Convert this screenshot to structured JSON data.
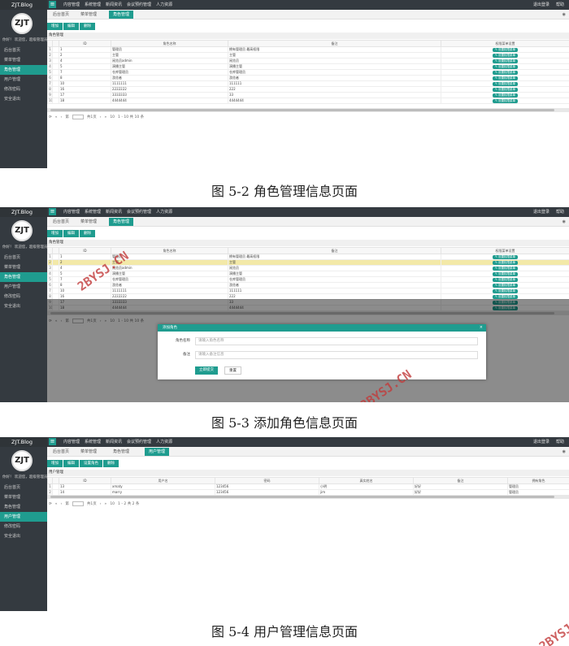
{
  "app": {
    "logo": "ZJT.Blog",
    "avatar_text": "ZJT",
    "welcome": "你好！ 欢迎您，超级管理员",
    "top_nav": [
      "内容管理",
      "系统管理",
      "新闻资讯",
      "会议预约管理",
      "人力资源"
    ],
    "top_right": [
      "退出登录",
      "帮助"
    ]
  },
  "shot1": {
    "sidebar": [
      "后台首页",
      "菜单管理",
      "角色管理",
      "用户管理",
      "修改密码",
      "安全退出"
    ],
    "active_index": 2,
    "tabs": [
      "后台首页",
      "菜单管理",
      "角色管理"
    ],
    "toolbar": [
      "增加",
      "编辑",
      "删除"
    ],
    "panel_title": "角色管理",
    "columns": [
      "ID",
      "角色名称",
      "备注",
      "权限菜单设置"
    ],
    "rows": [
      {
        "rn": "1",
        "id": "1",
        "name": "管理员",
        "remark": "拥有管理员 最高权限"
      },
      {
        "rn": "2",
        "id": "2",
        "name": "主管",
        "remark": "主管"
      },
      {
        "rn": "3",
        "id": "4",
        "name": "阅览员admin",
        "remark": "阅览员"
      },
      {
        "rn": "4",
        "id": "5",
        "name": "演播主管",
        "remark": "演播主管"
      },
      {
        "rn": "5",
        "id": "7",
        "name": "仓库管理员",
        "remark": "仓库管理员"
      },
      {
        "rn": "6",
        "id": "8",
        "name": "游览者",
        "remark": "游览者"
      },
      {
        "rn": "7",
        "id": "10",
        "name": "1111111",
        "remark": "111111"
      },
      {
        "rn": "8",
        "id": "16",
        "name": "2222222",
        "remark": "222"
      },
      {
        "rn": "9",
        "id": "17",
        "name": "3333333",
        "remark": "33"
      },
      {
        "rn": "10",
        "id": "18",
        "name": "4444444",
        "remark": "4444444"
      }
    ],
    "perm_label": "设置权限菜单",
    "pager": {
      "page_prefix": "第",
      "total_pages": "共1页",
      "size": "10",
      "summary": "1 - 10 共 10 条"
    },
    "caption": "图 5-2 角色管理信息页面"
  },
  "shot2": {
    "dialog_title": "添加角色",
    "name_label": "角色名称",
    "name_placeholder": "请输入角色名称",
    "remark_label": "备注",
    "remark_placeholder": "请输入备注信息",
    "submit": "立即提交",
    "reset": "重置",
    "caption": "图 5-3 添加角色信息页面"
  },
  "shot3": {
    "tabs": [
      "后台首页",
      "菜单管理",
      "角色管理",
      "用户管理"
    ],
    "toolbar": [
      "增加",
      "编辑",
      "设置角色",
      "删除"
    ],
    "panel_title": "用户管理",
    "columns": [
      "ID",
      "用户名",
      "密码",
      "真实姓名",
      "备注",
      "拥有角色"
    ],
    "rows": [
      {
        "rn": "1",
        "id": "13",
        "user": "xmaty",
        "pwd": "123456",
        "real": "小明",
        "remark": "好好",
        "role": "管理员"
      },
      {
        "rn": "2",
        "id": "14",
        "user": "marry",
        "pwd": "123456",
        "real": "jim",
        "remark": "好好",
        "role": "管理员"
      }
    ],
    "pager_summary": "1 - 2 共 2 条",
    "caption": "图 5-4 用户管理信息页面"
  },
  "watermark": "2BYSJ.CN"
}
